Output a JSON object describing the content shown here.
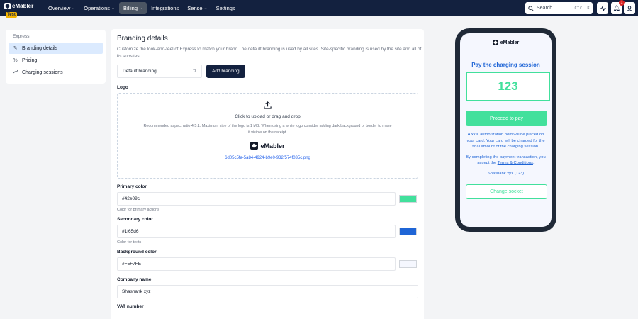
{
  "app": {
    "logo_text": "eMabler",
    "env_badge": "Test"
  },
  "nav": {
    "items": [
      {
        "label": "Overview",
        "chevron": true
      },
      {
        "label": "Operations",
        "chevron": true
      },
      {
        "label": "Billing",
        "chevron": true,
        "active": true
      },
      {
        "label": "Integrations",
        "chevron": false
      },
      {
        "label": "Sense",
        "chevron": true
      },
      {
        "label": "Settings",
        "chevron": false
      }
    ],
    "search_placeholder": "Search...",
    "search_shortcut": "Ctrl K",
    "notification_count": "1"
  },
  "sidebar": {
    "section": "Express",
    "items": [
      {
        "label": "Branding details",
        "icon": "edit-icon",
        "active": true
      },
      {
        "label": "Pricing",
        "icon": "percent-icon"
      },
      {
        "label": "Charging sessions",
        "icon": "chart-icon"
      }
    ]
  },
  "main": {
    "title": "Branding details",
    "description": "Customize the look-and-feel of Express to match your brand The default branding is used by all sites. Site-specific branding is used by the site and all of its subsites.",
    "branding_select": "Default branding",
    "add_branding": "Add branding",
    "logo": {
      "label": "Logo",
      "upload_title": "Click to upload or drag and drop",
      "upload_hint": "Recommended aspect ratio 4.5:1. Maximum size of the logo is 1 MB. When using a white logo consider adding dark background or border to make it visible on the receipt.",
      "preview_text": "eMabler",
      "file_name": "6d05c5fa-5a84-4924-b9e0-932f574f035c.png"
    },
    "primary_color": {
      "label": "Primary color",
      "value": "#42e09c",
      "help": "Color for primary actions",
      "swatch": "#42e09c"
    },
    "secondary_color": {
      "label": "Secondary color",
      "value": "#1f65d6",
      "help": "Color for texts",
      "swatch": "#1f65d6"
    },
    "background_color": {
      "label": "Background color",
      "value": "#F5F7FE",
      "swatch": "#F5F7FE"
    },
    "company_name": {
      "label": "Company name",
      "value": "Shashank xyz"
    },
    "vat_number": {
      "label": "VAT number"
    }
  },
  "preview": {
    "logo_text": "eMabler",
    "title": "Pay the charging session",
    "code": "123",
    "proceed_button": "Proceed to pay",
    "hold_text": "A xx € authorization hold will be placed on your card. Your card will be charged for the final amount of the charging session.",
    "terms_prefix": "By completing the payment transaction, you accept the",
    "terms_link": "Terms & Conditions",
    "terms_suffix": ".",
    "account": "Shashank xyz (123)",
    "change_socket": "Change socket"
  }
}
